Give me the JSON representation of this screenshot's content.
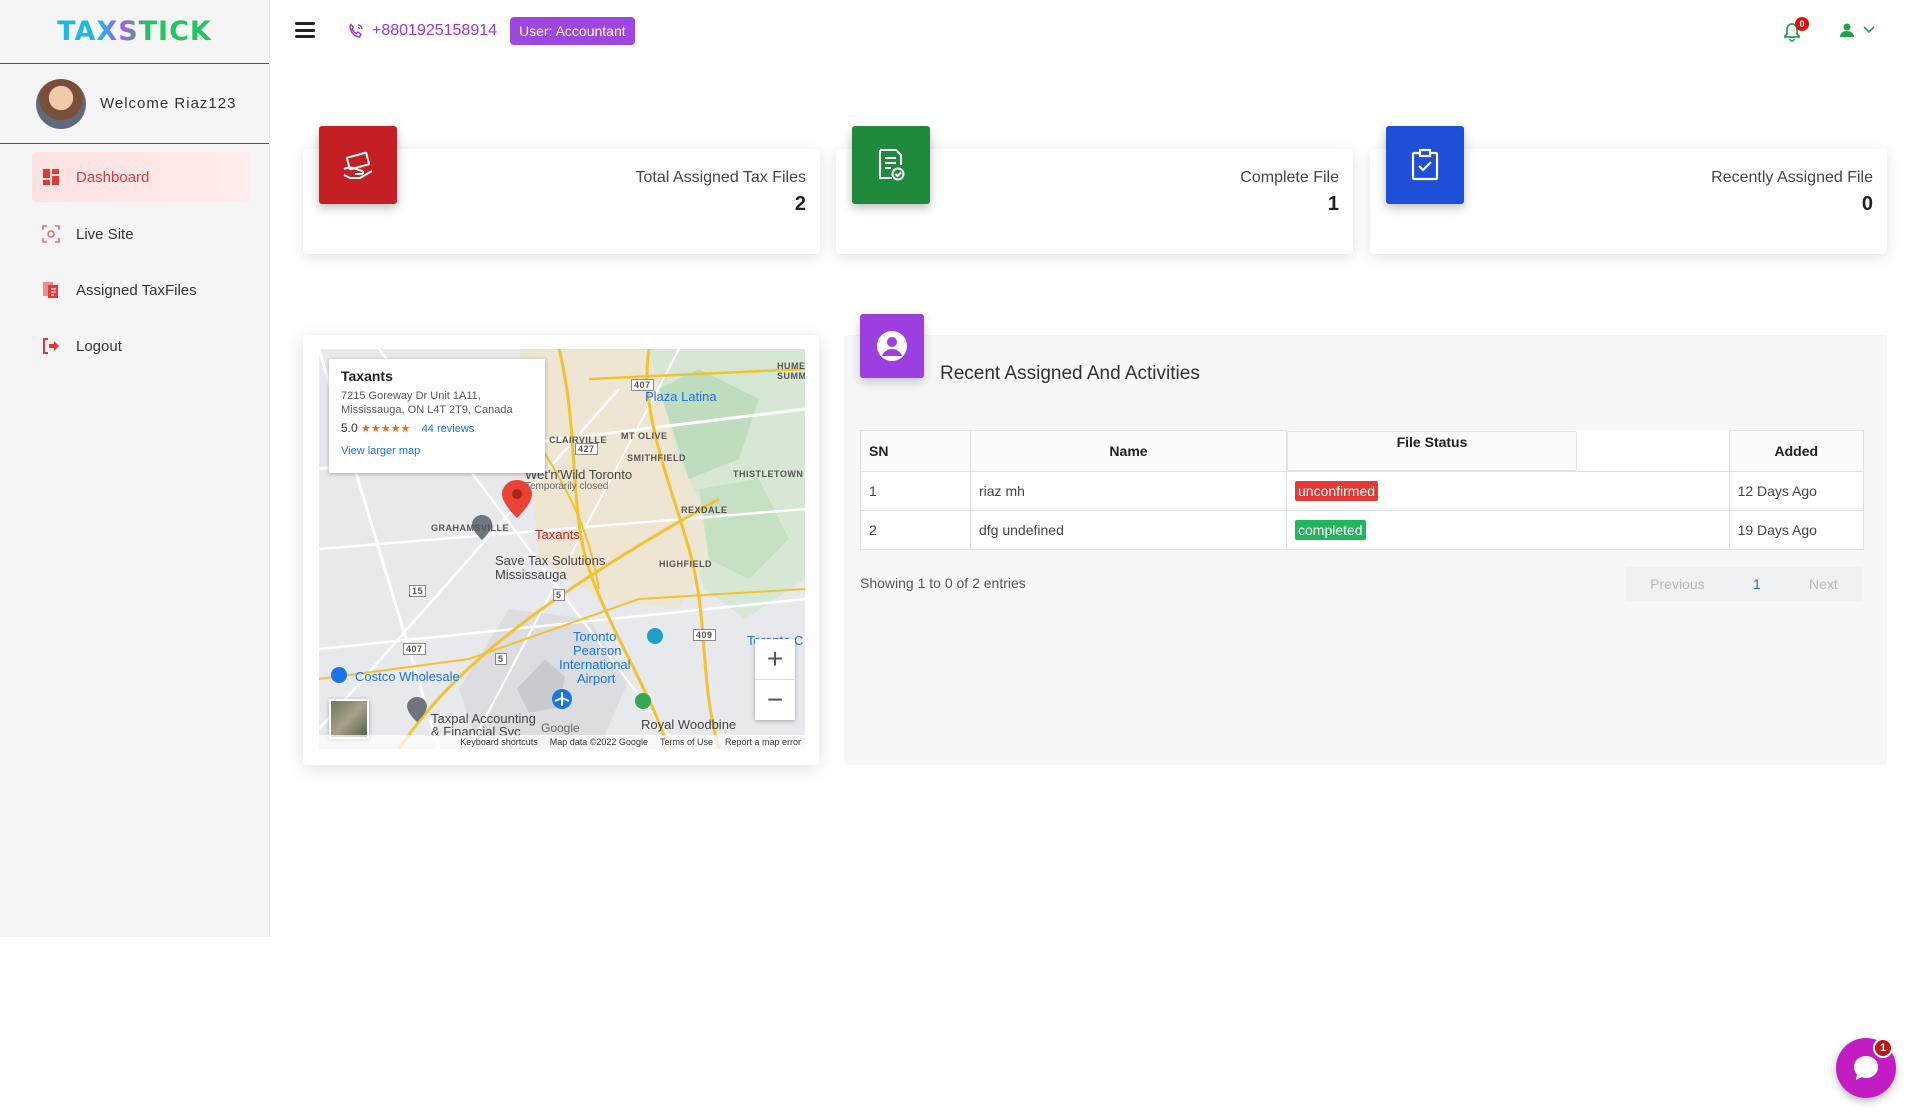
{
  "brand": {
    "logo_text": "TAXSTICK"
  },
  "sidebar": {
    "welcome": "Welcome Riaz123",
    "items": [
      {
        "label": "Dashboard",
        "icon": "dashboard-icon",
        "active": true
      },
      {
        "label": "Live Site",
        "icon": "live-site-icon",
        "active": false
      },
      {
        "label": "Assigned TaxFiles",
        "icon": "tax-files-icon",
        "active": false
      },
      {
        "label": "Logout",
        "icon": "logout-icon",
        "active": false
      }
    ]
  },
  "header": {
    "phone": "+8801925158914",
    "user_badge": "User:  Accountant",
    "notification_count": "0"
  },
  "stats": [
    {
      "label": "Total Assigned Tax Files",
      "value": "2",
      "color": "#c41f24",
      "icon": "money-hand-icon"
    },
    {
      "label": "Complete File",
      "value": "1",
      "color": "#1f8a3c",
      "icon": "file-check-icon"
    },
    {
      "label": "Recently Assigned File",
      "value": "0",
      "color": "#1e4fd6",
      "icon": "clipboard-check-icon"
    }
  ],
  "map": {
    "place_name": "Taxants",
    "address_line1": "7215 Goreway Dr Unit 1A11,",
    "address_line2": "Mississauga, ON L4T 2T9, Canada",
    "rating": "5.0",
    "stars": "★★★★★",
    "reviews": "44 reviews",
    "view_larger": "View larger map",
    "labels": {
      "plaza_latina": "Plaza Latina",
      "clairville": "CLAIRVILLE",
      "mt_olive": "MT OLIVE",
      "smithfield": "SMITHFIELD",
      "thistletown": "THISTLETOWN",
      "rexdale": "REXDALE",
      "grahamsville": "GRAHAMSVILLE",
      "highfield": "HIGHFIELD",
      "wet_n_wild": "Wet'n'Wild Toronto",
      "temporarily_closed": "Temporarily closed",
      "taxants_pin": "Taxants",
      "save_tax": "Save Tax Solutions",
      "save_tax_2": "Mississauga",
      "airport_1": "Toronto",
      "airport_2": "Pearson",
      "airport_3": "International",
      "airport_4": "Airport",
      "costco": "Costco Wholesale",
      "taxpal": "Taxpal Accounting",
      "taxpal_2": "& Financial Svc",
      "royal_woodbine": "Royal Woodbine",
      "toronto_c": "Toronto C",
      "hume": "HUME",
      "summ": "SUMM",
      "r407a": "407",
      "r427": "427",
      "r409": "409",
      "r15": "15",
      "r5": "5",
      "r5b": "5",
      "r407b": "407"
    },
    "footer": {
      "shortcuts": "Keyboard shortcuts",
      "mapdata": "Map data ©2022 Google",
      "terms": "Terms of Use",
      "report": "Report a map error"
    },
    "google": "Google"
  },
  "activity": {
    "title": "Recent Assigned And Activities",
    "columns": [
      "SN",
      "Name",
      "File Status",
      "Added"
    ],
    "rows": [
      {
        "sn": "1",
        "name": "riaz mh",
        "status": "unconfirmed",
        "added": "12 Days Ago"
      },
      {
        "sn": "2",
        "name": "dfg undefined",
        "status": "completed",
        "added": "19 Days Ago"
      }
    ],
    "showing": "Showing 1 to 0 of 2 entries",
    "pager": {
      "previous": "Previous",
      "page": "1",
      "next": "Next"
    }
  },
  "chat": {
    "badge": "1"
  }
}
